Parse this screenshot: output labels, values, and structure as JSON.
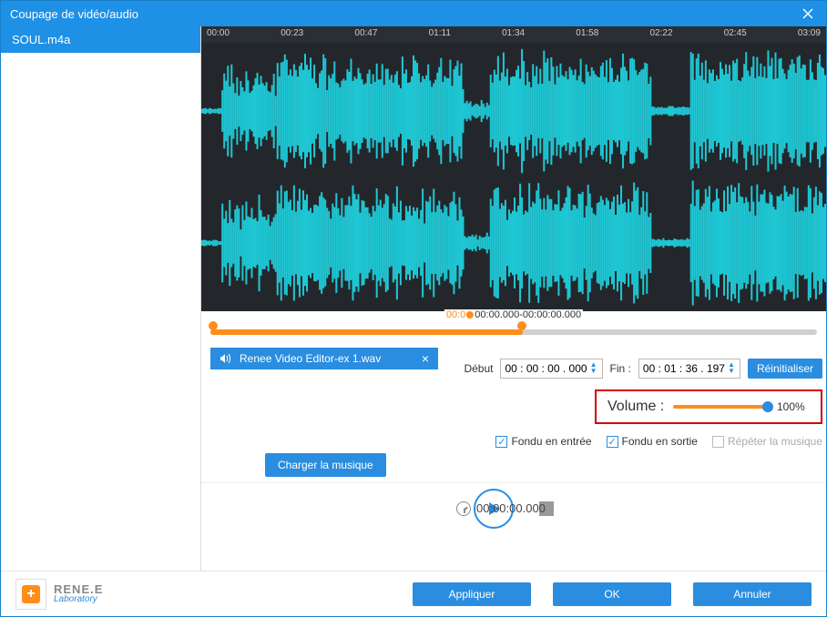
{
  "window": {
    "title": "Coupage de vidéo/audio"
  },
  "sidebar": {
    "items": [
      {
        "label": "SOUL.m4a"
      }
    ]
  },
  "ruler": {
    "ticks": [
      "00:00",
      "00:23",
      "00:47",
      "01:11",
      "01:34",
      "01:58",
      "02:22",
      "02:45",
      "03:09"
    ]
  },
  "scrubber": {
    "position_display": "00:00.000-00:00:00.000"
  },
  "audio_chip": {
    "label": "Renee Video Editor-ex 1.wav"
  },
  "time": {
    "start_label": "Début",
    "start_value": "00 : 00 : 00 . 000",
    "end_label": "Fin :",
    "end_value": "00 : 01 : 36 . 197",
    "reset": "Réinitialiser"
  },
  "volume": {
    "label": "Volume :",
    "value": "100%"
  },
  "checks": {
    "fade_in": "Fondu en entrée",
    "fade_out": "Fondu en sortie",
    "repeat": "Répéter la musique"
  },
  "load_music": "Charger la musique",
  "playbar": {
    "clock": "00:00:00.000"
  },
  "logo": {
    "line1": "RENE.E",
    "line2": "Laboratory"
  },
  "footer": {
    "apply": "Appliquer",
    "ok": "OK",
    "cancel": "Annuler"
  }
}
